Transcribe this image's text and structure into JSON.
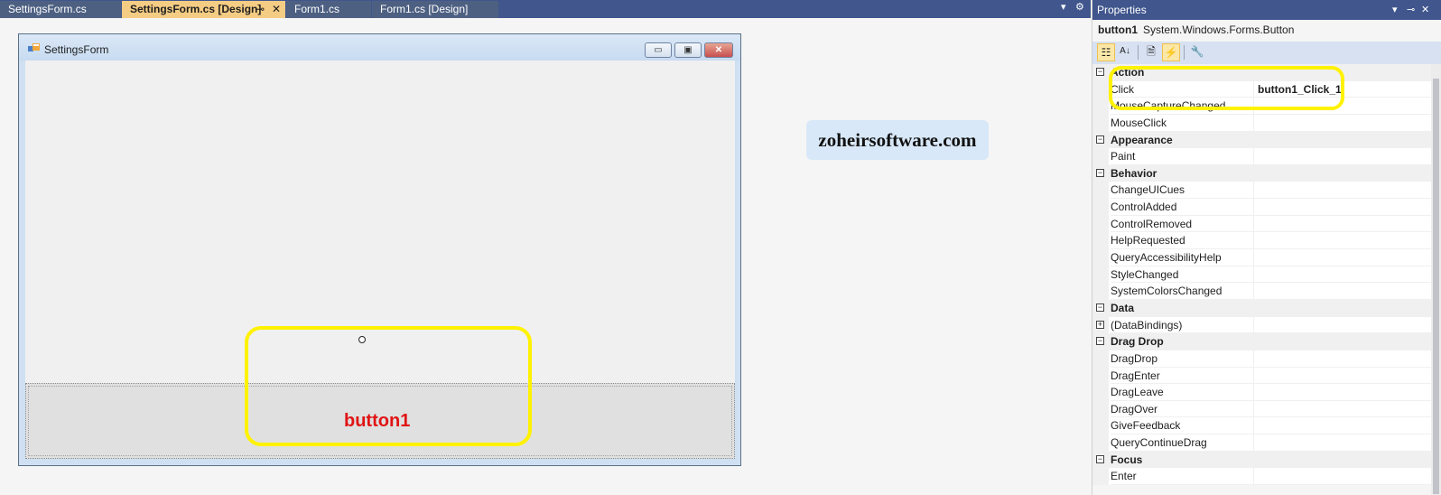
{
  "tabs": [
    {
      "label": "SettingsForm.cs",
      "active": false
    },
    {
      "label": "SettingsForm.cs [Design]",
      "active": true
    },
    {
      "label": "Form1.cs",
      "active": false
    },
    {
      "label": "Form1.cs [Design]",
      "active": false
    }
  ],
  "tab_icons": {
    "pin": "⊸",
    "close": "✕",
    "dropdown": "▾",
    "settings": "⚙"
  },
  "form": {
    "title": "SettingsForm",
    "caption_buttons": {
      "minimize": "▭",
      "maximize": "▣",
      "close": "✕"
    },
    "button1_text": "button1"
  },
  "watermark": "zoheirsoftware.com",
  "properties": {
    "title": "Properties",
    "header_icons": {
      "dropdown": "▾",
      "pin": "⊸",
      "close": "✕"
    },
    "object_name": "button1",
    "object_type": "System.Windows.Forms.Button",
    "toolbar": {
      "categorized_icon": "☷",
      "alphabetical_icon": "A↓",
      "properties_icon": "🗎",
      "events_icon": "⚡",
      "property_pages_icon": "🔧"
    },
    "rows": [
      {
        "kind": "cat",
        "label": "Action",
        "toggle": "−"
      },
      {
        "kind": "prop",
        "name": "Click",
        "value": "button1_Click_1"
      },
      {
        "kind": "prop",
        "name": "MouseCaptureChanged",
        "value": ""
      },
      {
        "kind": "prop",
        "name": "MouseClick",
        "value": ""
      },
      {
        "kind": "cat",
        "label": "Appearance",
        "toggle": "−"
      },
      {
        "kind": "prop",
        "name": "Paint",
        "value": ""
      },
      {
        "kind": "cat",
        "label": "Behavior",
        "toggle": "−"
      },
      {
        "kind": "prop",
        "name": "ChangeUICues",
        "value": ""
      },
      {
        "kind": "prop",
        "name": "ControlAdded",
        "value": ""
      },
      {
        "kind": "prop",
        "name": "ControlRemoved",
        "value": ""
      },
      {
        "kind": "prop",
        "name": "HelpRequested",
        "value": ""
      },
      {
        "kind": "prop",
        "name": "QueryAccessibilityHelp",
        "value": ""
      },
      {
        "kind": "prop",
        "name": "StyleChanged",
        "value": ""
      },
      {
        "kind": "prop",
        "name": "SystemColorsChanged",
        "value": ""
      },
      {
        "kind": "cat",
        "label": "Data",
        "toggle": "−"
      },
      {
        "kind": "expand",
        "name": "(DataBindings)",
        "value": "",
        "toggle": "+"
      },
      {
        "kind": "cat",
        "label": "Drag Drop",
        "toggle": "−"
      },
      {
        "kind": "prop",
        "name": "DragDrop",
        "value": ""
      },
      {
        "kind": "prop",
        "name": "DragEnter",
        "value": ""
      },
      {
        "kind": "prop",
        "name": "DragLeave",
        "value": ""
      },
      {
        "kind": "prop",
        "name": "DragOver",
        "value": ""
      },
      {
        "kind": "prop",
        "name": "GiveFeedback",
        "value": ""
      },
      {
        "kind": "prop",
        "name": "QueryContinueDrag",
        "value": ""
      },
      {
        "kind": "cat",
        "label": "Focus",
        "toggle": "−"
      },
      {
        "kind": "prop",
        "name": "Enter",
        "value": ""
      }
    ]
  },
  "colors": {
    "highlight": "#fff200",
    "active_tab": "#f5cc84",
    "tool_window_header": "#40568d",
    "button_text": "#e01414"
  }
}
